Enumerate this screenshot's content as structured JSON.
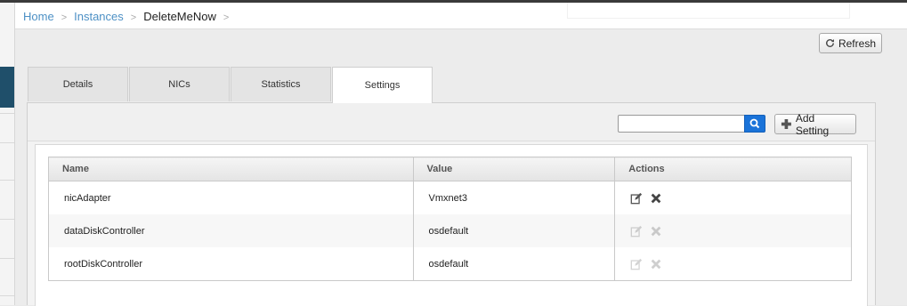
{
  "breadcrumb": {
    "home": "Home",
    "instances": "Instances",
    "current": "DeleteMeNow",
    "separator": ">"
  },
  "toolbar": {
    "refresh_label": "Refresh"
  },
  "tabs": [
    {
      "label": "Details"
    },
    {
      "label": "NICs"
    },
    {
      "label": "Statistics"
    },
    {
      "label": "Settings",
      "active": true
    }
  ],
  "settings": {
    "search_placeholder": "",
    "add_label": "Add Setting",
    "columns": {
      "name": "Name",
      "value": "Value",
      "actions": "Actions"
    },
    "rows": [
      {
        "name": "nicAdapter",
        "value": "Vmxnet3",
        "actions_enabled": true
      },
      {
        "name": "dataDiskController",
        "value": "osdefault",
        "actions_enabled": false
      },
      {
        "name": "rootDiskController",
        "value": "osdefault",
        "actions_enabled": false
      }
    ]
  },
  "colors": {
    "link": "#4d90c5",
    "search_button": "#1a73d9",
    "nav_active": "#1f4f6a"
  },
  "icons": [
    "refresh-icon",
    "search-icon",
    "plus-icon",
    "edit-icon",
    "delete-icon"
  ]
}
